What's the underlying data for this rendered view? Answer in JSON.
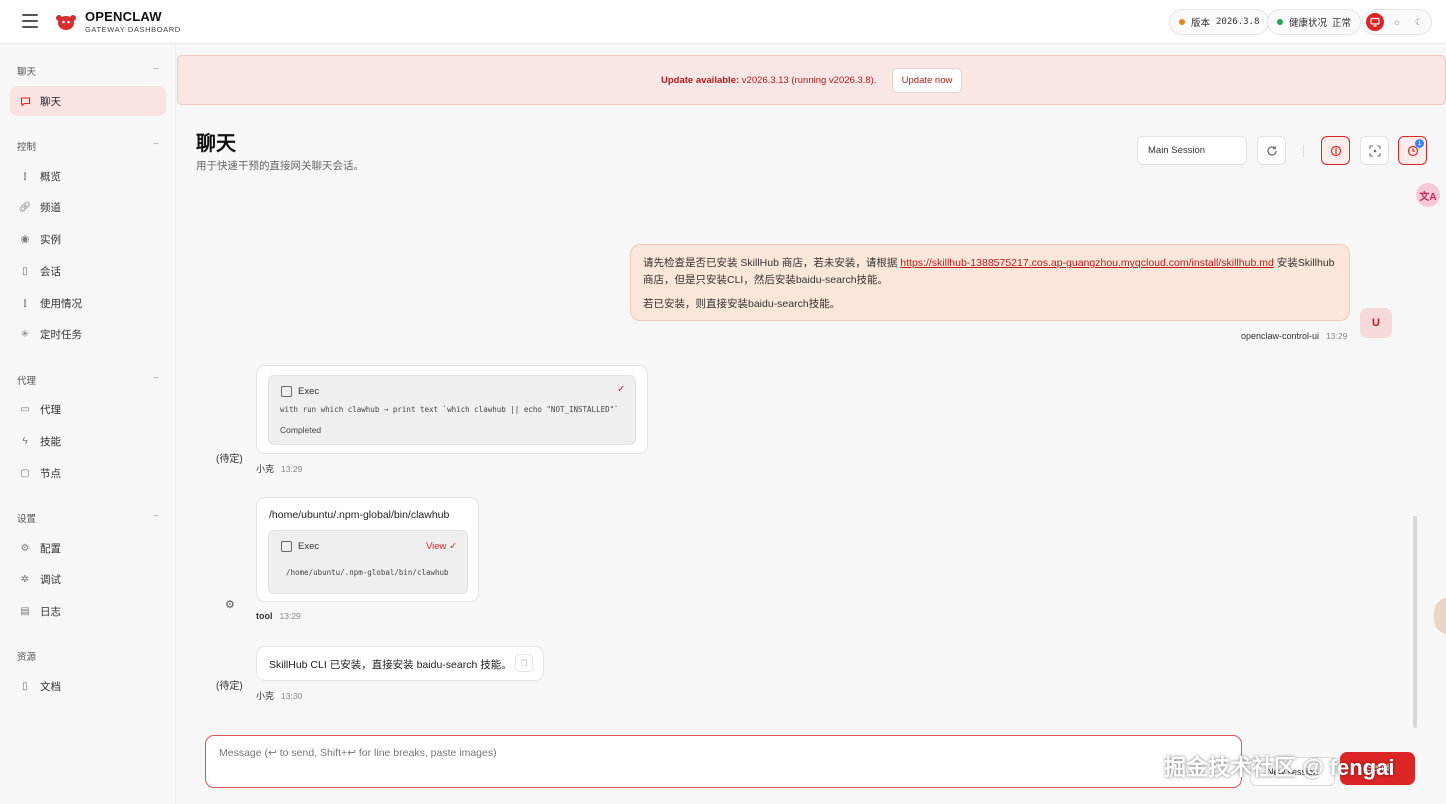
{
  "brand": {
    "title": "OPENCLAW",
    "subtitle": "GATEWAY DASHBOARD"
  },
  "status": {
    "version_label": "版本",
    "version_value": "2026.3.8",
    "health_label": "健康状况",
    "health_value": "正常",
    "version_dot_color": "#e08a1e",
    "health_dot_color": "#22a45d"
  },
  "sidebar": {
    "chat_section": "聊天",
    "chat_items": [
      {
        "label": "聊天",
        "icon": "chat-icon"
      }
    ],
    "control_section": "控制",
    "control_items": [
      {
        "label": "概览",
        "icon": "bar-chart-icon"
      },
      {
        "label": "频道",
        "icon": "link-icon"
      },
      {
        "label": "实例",
        "icon": "radio-icon"
      },
      {
        "label": "会话",
        "icon": "document-icon"
      },
      {
        "label": "使用情况",
        "icon": "bar-chart-icon"
      },
      {
        "label": "定时任务",
        "icon": "loader-icon"
      }
    ],
    "agent_section": "代理",
    "agent_items": [
      {
        "label": "代理",
        "icon": "folder-icon"
      },
      {
        "label": "技能",
        "icon": "zap-icon"
      },
      {
        "label": "节点",
        "icon": "monitor-icon"
      }
    ],
    "settings_section": "设置",
    "settings_items": [
      {
        "label": "配置",
        "icon": "gear-icon"
      },
      {
        "label": "调试",
        "icon": "bug-icon"
      },
      {
        "label": "日志",
        "icon": "file-text-icon"
      }
    ],
    "resources_section": "资源",
    "resources_items": [
      {
        "label": "文档",
        "icon": "book-icon"
      }
    ]
  },
  "banner": {
    "strong": "Update available:",
    "text": " v2026.3.13 (running v2026.3.8).",
    "button": "Update now"
  },
  "page": {
    "title": "聊天",
    "subtitle": "用于快速干预的直接网关聊天会话。",
    "session": "Main Session",
    "notification_badge": "1"
  },
  "messages": {
    "user": {
      "text_before": "请先检查是否已安装 SkillHub 商店，若未安装，请根据 ",
      "link": "https://skillhub-1388575217.cos.ap-guangzhou.myqcloud.com/install/skillhub.md",
      "text_after": " 安装Skillhub商店，但是只安装CLI，然后安装baidu-search技能。",
      "line2": "若已安装，则直接安装baidu-search技能。",
      "sender": "openclaw-control-ui",
      "time": "13:29",
      "avatar": "U"
    },
    "exec1": {
      "pending": "(待定)",
      "tool": "Exec",
      "command": "with run which clawhub → print text `which clawhub || echo \"NOT_INSTALLED\"`",
      "status": "Completed",
      "sender": "小克",
      "time": "13:29"
    },
    "tool_result": {
      "path": "/home/ubuntu/.npm-global/bin/clawhub",
      "tool": "Exec",
      "view": "View",
      "output": "/home/ubuntu/.npm-global/bin/clawhub",
      "sender": "tool",
      "time": "13:29"
    },
    "reply": {
      "pending": "(待定)",
      "text": "SkillHub CLI 已安装，直接安装 baidu-search 技能。",
      "sender": "小克",
      "time": "13:30"
    }
  },
  "composer": {
    "placeholder": "Message (↩ to send, Shift+↩ for line breaks, paste images)",
    "new_session": "New session",
    "send": "Send"
  },
  "watermark": "掘金技术社区 @ fengai",
  "accent_color": "#dc2626"
}
